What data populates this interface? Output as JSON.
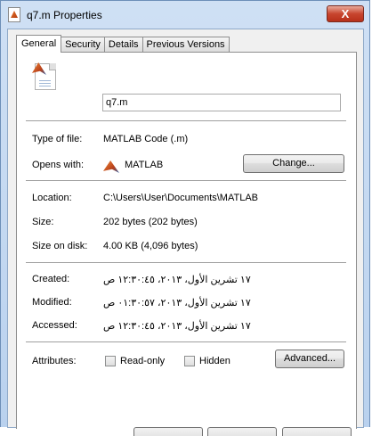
{
  "window": {
    "title": "q7.m Properties",
    "close_glyph": "X"
  },
  "tabs": [
    "General",
    "Security",
    "Details",
    "Previous Versions"
  ],
  "file": {
    "name": "q7.m",
    "icon": "matlab-file-icon"
  },
  "type_section": {
    "type_label": "Type of file:",
    "type_value": "MATLAB Code (.m)",
    "opens_label": "Opens with:",
    "opens_value": "MATLAB",
    "opens_icon": "matlab-logo-icon",
    "change_button": "Change..."
  },
  "location_section": {
    "location_label": "Location:",
    "location_value": "C:\\Users\\User\\Documents\\MATLAB",
    "size_label": "Size:",
    "size_value": "202 bytes (202 bytes)",
    "size_disk_label": "Size on disk:",
    "size_disk_value": "4.00 KB (4,096 bytes)"
  },
  "dates_section": {
    "created_label": "Created:",
    "created_value": "١٧ تشرين الأول، ٢٠١٣، ١٢:٣٠:٤٥ ص",
    "modified_label": "Modified:",
    "modified_value": "١٧ تشرين الأول، ٢٠١٣، ٠١:٣٠:٥٧ ص",
    "accessed_label": "Accessed:",
    "accessed_value": "١٧ تشرين الأول، ٢٠١٣، ١٢:٣٠:٤٥ ص"
  },
  "attributes": {
    "label": "Attributes:",
    "readonly_label": "Read-only",
    "readonly_checked": false,
    "hidden_label": "Hidden",
    "hidden_checked": false,
    "advanced_button": "Advanced..."
  },
  "colors": {
    "title_bar": "#c4d9f1",
    "close_button": "#c8452e",
    "panel_bg": "#ffffff",
    "dialog_bg": "#f0f0f0"
  }
}
